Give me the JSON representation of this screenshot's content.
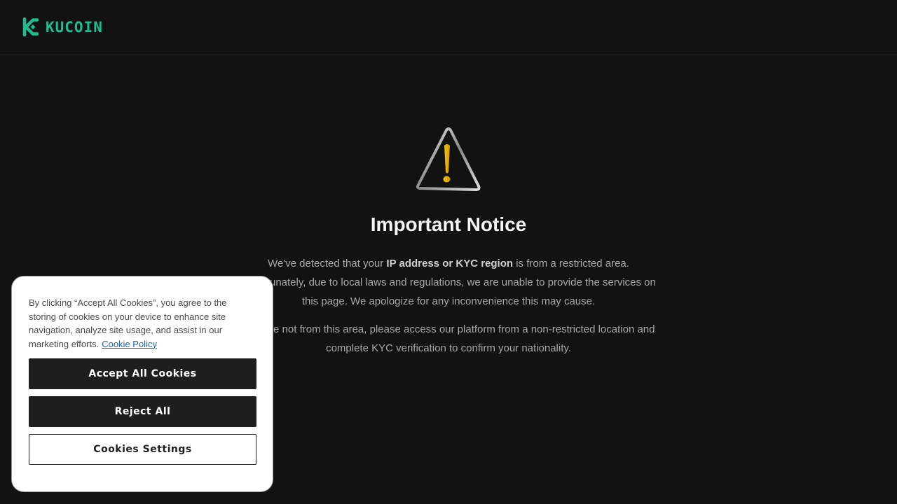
{
  "brand": {
    "name": "KUCOIN",
    "color": "#1ebd8f",
    "icon": "kucoin-logo-icon"
  },
  "notice": {
    "icon": "warning-triangle-icon",
    "title": "Important Notice",
    "para1": {
      "before": "We've detected that your ",
      "bold": "IP address or KYC region",
      "after": " is from a restricted area. Unfortunately, due to local laws and regulations, we are unable to provide the services on this page. We apologize for any inconvenience this may cause."
    },
    "para2": "If you're not from this area, please access our platform from a non-restricted location and complete KYC verification to confirm your nationality."
  },
  "cookie_banner": {
    "text": "By clicking “Accept All Cookies”, you agree to the storing of cookies on your device to enhance site navigation, analyze site usage, and assist in our marketing efforts.",
    "policy_link": "Cookie Policy",
    "accept_label": "Accept All Cookies",
    "reject_label": "Reject All",
    "settings_label": "Cookies Settings"
  }
}
